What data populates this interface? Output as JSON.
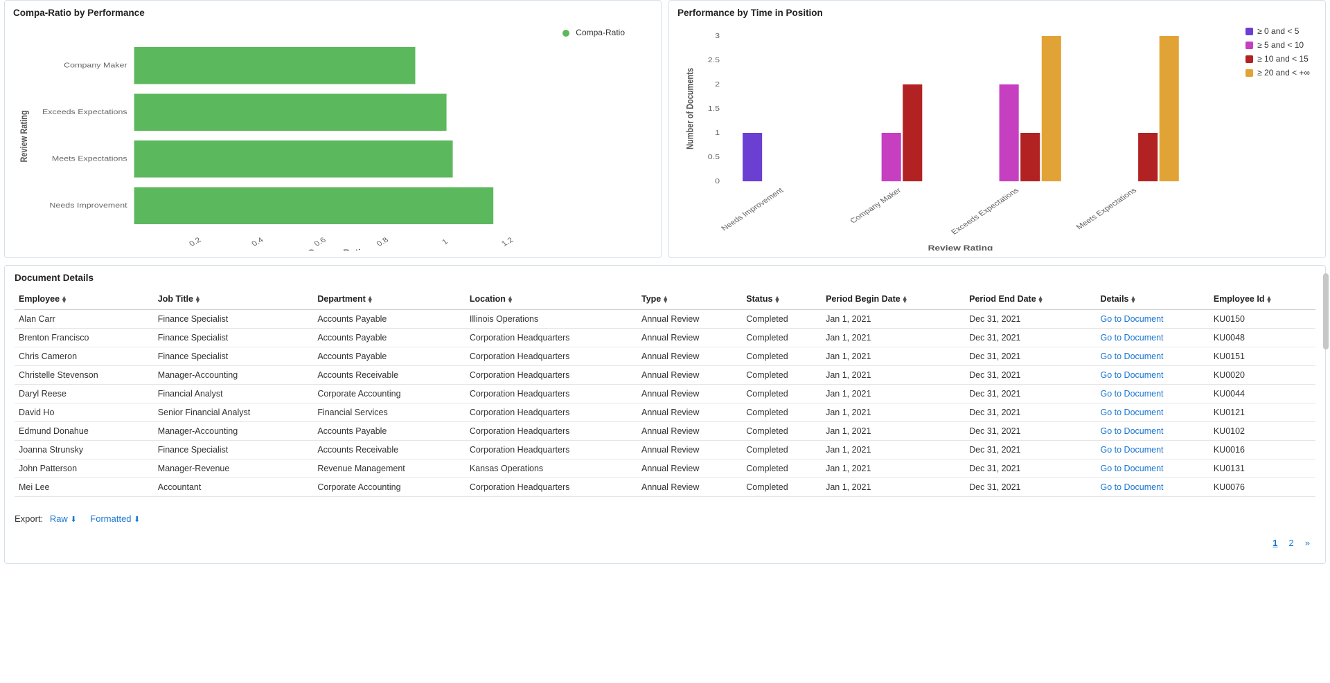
{
  "chart_data": [
    {
      "id": "compa_ratio",
      "type": "bar",
      "orientation": "horizontal",
      "title": "Compa-Ratio by Performance",
      "xlabel": "Compa-Ratio",
      "ylabel": "Review Rating",
      "xticks": [
        0.2,
        0.4,
        0.6,
        0.8,
        1,
        1.2
      ],
      "xlim": [
        0,
        1.3
      ],
      "categories": [
        "Company Maker",
        "Exceeds Expectations",
        "Meets Expectations",
        "Needs Improvement"
      ],
      "series": [
        {
          "name": "Compa-Ratio",
          "color": "#5cb85c",
          "values": [
            0.9,
            1.0,
            1.02,
            1.15
          ]
        }
      ]
    },
    {
      "id": "perf_time",
      "type": "bar",
      "orientation": "vertical",
      "grouped": true,
      "title": "Performance by Time in Position",
      "xlabel": "Review Rating",
      "ylabel": "Number of Documents",
      "yticks": [
        0,
        0.5,
        1,
        1.5,
        2,
        2.5,
        3
      ],
      "ylim": [
        0,
        3
      ],
      "categories": [
        "Needs Improvement",
        "Company Maker",
        "Exceeds Expectations",
        "Meets Expectations"
      ],
      "series": [
        {
          "name": "≥ 0 and < 5",
          "color": "#6a3fd1",
          "values": [
            1,
            0,
            0,
            0
          ]
        },
        {
          "name": "≥ 5 and < 10",
          "color": "#c53fc0",
          "values": [
            0,
            1,
            2,
            0
          ]
        },
        {
          "name": "≥ 10 and < 15",
          "color": "#b22222",
          "values": [
            0,
            2,
            1,
            1
          ]
        },
        {
          "name": "≥ 20 and < +∞",
          "color": "#e2a336",
          "values": [
            0,
            0,
            3,
            3
          ]
        }
      ]
    }
  ],
  "details": {
    "title": "Document Details",
    "columns": [
      "Employee",
      "Job Title",
      "Department",
      "Location",
      "Type",
      "Status",
      "Period Begin Date",
      "Period End Date",
      "Details",
      "Employee Id"
    ],
    "link_label": "Go to Document",
    "rows": [
      {
        "employee": "Alan Carr",
        "job": "Finance Specialist",
        "dept": "Accounts Payable",
        "loc": "Illinois Operations",
        "type": "Annual Review",
        "status": "Completed",
        "begin": "Jan 1, 2021",
        "end": "Dec 31, 2021",
        "eid": "KU0150"
      },
      {
        "employee": "Brenton Francisco",
        "job": "Finance Specialist",
        "dept": "Accounts Payable",
        "loc": "Corporation Headquarters",
        "type": "Annual Review",
        "status": "Completed",
        "begin": "Jan 1, 2021",
        "end": "Dec 31, 2021",
        "eid": "KU0048"
      },
      {
        "employee": "Chris Cameron",
        "job": "Finance Specialist",
        "dept": "Accounts Payable",
        "loc": "Corporation Headquarters",
        "type": "Annual Review",
        "status": "Completed",
        "begin": "Jan 1, 2021",
        "end": "Dec 31, 2021",
        "eid": "KU0151"
      },
      {
        "employee": "Christelle Stevenson",
        "job": "Manager-Accounting",
        "dept": "Accounts Receivable",
        "loc": "Corporation Headquarters",
        "type": "Annual Review",
        "status": "Completed",
        "begin": "Jan 1, 2021",
        "end": "Dec 31, 2021",
        "eid": "KU0020"
      },
      {
        "employee": "Daryl Reese",
        "job": "Financial Analyst",
        "dept": "Corporate Accounting",
        "loc": "Corporation Headquarters",
        "type": "Annual Review",
        "status": "Completed",
        "begin": "Jan 1, 2021",
        "end": "Dec 31, 2021",
        "eid": "KU0044"
      },
      {
        "employee": "David Ho",
        "job": "Senior Financial Analyst",
        "dept": "Financial Services",
        "loc": "Corporation Headquarters",
        "type": "Annual Review",
        "status": "Completed",
        "begin": "Jan 1, 2021",
        "end": "Dec 31, 2021",
        "eid": "KU0121"
      },
      {
        "employee": "Edmund Donahue",
        "job": "Manager-Accounting",
        "dept": "Accounts Payable",
        "loc": "Corporation Headquarters",
        "type": "Annual Review",
        "status": "Completed",
        "begin": "Jan 1, 2021",
        "end": "Dec 31, 2021",
        "eid": "KU0102"
      },
      {
        "employee": "Joanna Strunsky",
        "job": "Finance Specialist",
        "dept": "Accounts Receivable",
        "loc": "Corporation Headquarters",
        "type": "Annual Review",
        "status": "Completed",
        "begin": "Jan 1, 2021",
        "end": "Dec 31, 2021",
        "eid": "KU0016"
      },
      {
        "employee": "John Patterson",
        "job": "Manager-Revenue",
        "dept": "Revenue Management",
        "loc": "Kansas Operations",
        "type": "Annual Review",
        "status": "Completed",
        "begin": "Jan 1, 2021",
        "end": "Dec 31, 2021",
        "eid": "KU0131"
      },
      {
        "employee": "Mei Lee",
        "job": "Accountant",
        "dept": "Corporate Accounting",
        "loc": "Corporation Headquarters",
        "type": "Annual Review",
        "status": "Completed",
        "begin": "Jan 1, 2021",
        "end": "Dec 31, 2021",
        "eid": "KU0076"
      }
    ],
    "export_label": "Export:",
    "export_raw": "Raw",
    "export_formatted": "Formatted",
    "pages": [
      "1",
      "2"
    ],
    "current_page": "1"
  }
}
